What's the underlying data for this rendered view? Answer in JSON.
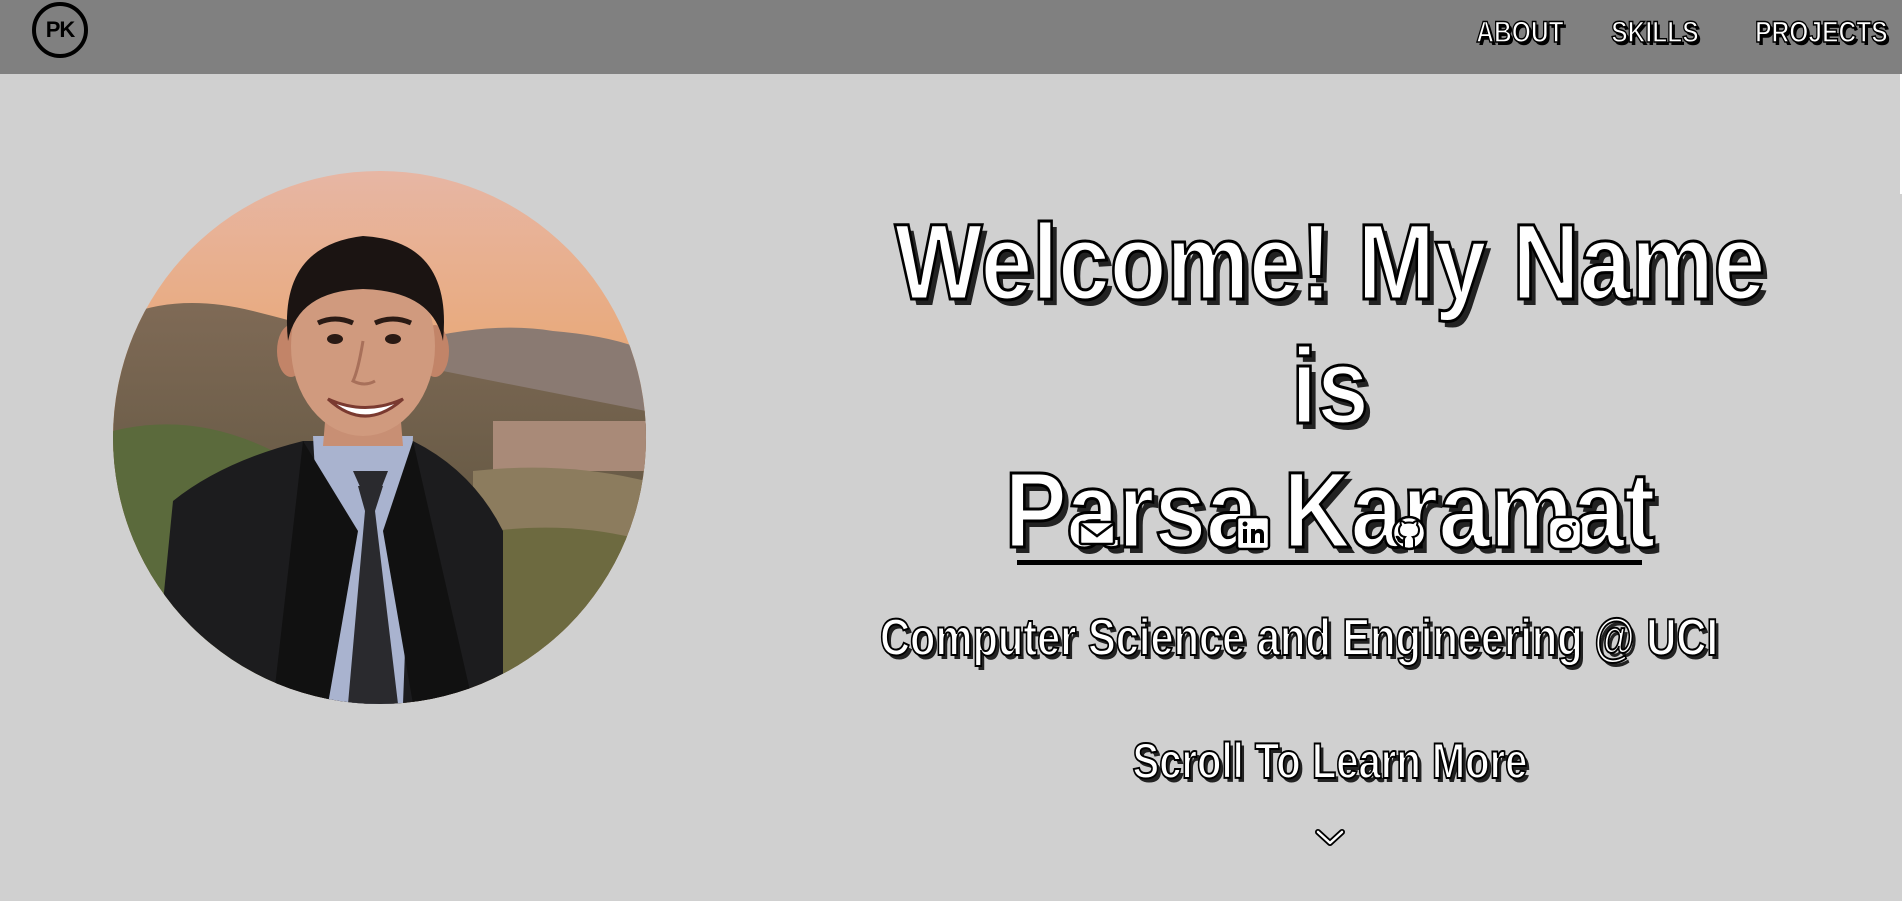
{
  "navbar": {
    "logo_text": "PK",
    "links": [
      "ABOUT",
      "SKILLS",
      "PROJECTS"
    ]
  },
  "hero": {
    "headline_line1": "Welcome! My Name is",
    "headline_line2": "Parsa Karamat",
    "social_icons": [
      "mail-icon",
      "linkedin-icon",
      "github-icon",
      "instagram-icon"
    ],
    "subtitle": "Computer Science and Engineering @ UCI",
    "scroll_text": "Scroll To Learn More"
  },
  "colors": {
    "page_background": "#d0d0d0",
    "navbar_background": "#808080",
    "text_fill": "#ffffff",
    "text_outline": "#000000"
  }
}
